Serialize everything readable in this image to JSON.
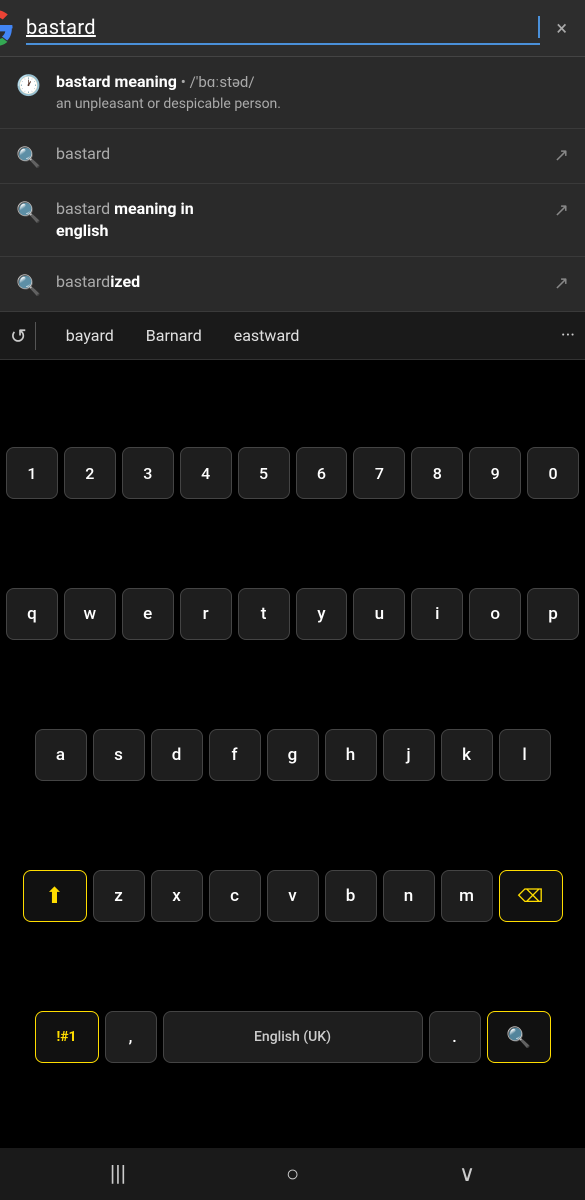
{
  "search": {
    "query": "bastard",
    "clear_label": "×",
    "cursor_visible": true
  },
  "suggestions": [
    {
      "id": "history",
      "icon_type": "clock",
      "title_html": "<strong>bastard meaning</strong> • <span class='phonetic'>/'bɑːstəd/</span>",
      "subtitle": "an unpleasant or despicable person.",
      "has_arrow": false
    },
    {
      "id": "search1",
      "icon_type": "search",
      "title": "bastard",
      "title_bold": "",
      "has_arrow": true
    },
    {
      "id": "search2",
      "icon_type": "search",
      "title_part1": "bastard",
      "title_part2": " meaning in english",
      "has_arrow": true
    },
    {
      "id": "search3",
      "icon_type": "search",
      "title_part1": "bastard",
      "title_part2": "ized",
      "has_arrow": true
    }
  ],
  "keyboard": {
    "word_suggestions": [
      "bayard",
      "Barnard",
      "eastward"
    ],
    "more_label": "···",
    "rows": {
      "numbers": [
        "1",
        "2",
        "3",
        "4",
        "5",
        "6",
        "7",
        "8",
        "9",
        "0"
      ],
      "row1": [
        "q",
        "w",
        "e",
        "r",
        "t",
        "y",
        "u",
        "i",
        "o",
        "p"
      ],
      "row2": [
        "a",
        "s",
        "d",
        "f",
        "g",
        "h",
        "j",
        "k",
        "l"
      ],
      "row3": [
        "z",
        "x",
        "c",
        "v",
        "b",
        "n",
        "m"
      ],
      "bottom": {
        "special": "!#1",
        "comma": ",",
        "spacebar_label": "English (UK)",
        "period": ".",
        "search": "🔍"
      }
    }
  },
  "bottom_nav": {
    "back_icon": "|||",
    "home_icon": "○",
    "recents_icon": "∨"
  }
}
